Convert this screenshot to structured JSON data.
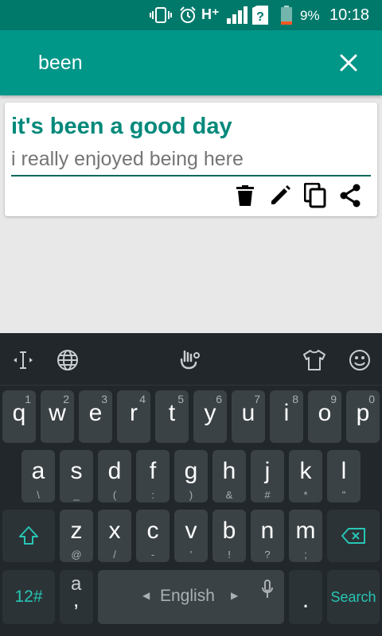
{
  "status_bar": {
    "network": "H⁺",
    "battery_percent": "9%",
    "time": "10:18"
  },
  "search": {
    "value": "been"
  },
  "card": {
    "title": "it's been a good day",
    "subtitle": "i really enjoyed being here"
  },
  "keyboard": {
    "row1": [
      {
        "key": "q",
        "hint": "1"
      },
      {
        "key": "w",
        "hint": "2"
      },
      {
        "key": "e",
        "hint": "3"
      },
      {
        "key": "r",
        "hint": "4"
      },
      {
        "key": "t",
        "hint": "5"
      },
      {
        "key": "y",
        "hint": "6"
      },
      {
        "key": "u",
        "hint": "7"
      },
      {
        "key": "i",
        "hint": "8"
      },
      {
        "key": "o",
        "hint": "9"
      },
      {
        "key": "p",
        "hint": "0"
      }
    ],
    "row2": [
      {
        "key": "a",
        "sub": "\\"
      },
      {
        "key": "s",
        "sub": "_"
      },
      {
        "key": "d",
        "sub": "("
      },
      {
        "key": "f",
        "sub": ":"
      },
      {
        "key": "g",
        "sub": ")"
      },
      {
        "key": "h",
        "sub": "&"
      },
      {
        "key": "j",
        "sub": "#"
      },
      {
        "key": "k",
        "sub": "*"
      },
      {
        "key": "l",
        "sub": "\""
      }
    ],
    "row3": [
      {
        "key": "z",
        "sub": "@"
      },
      {
        "key": "x",
        "sub": "/"
      },
      {
        "key": "c",
        "sub": "-"
      },
      {
        "key": "v",
        "sub": "'"
      },
      {
        "key": "b",
        "sub": "!"
      },
      {
        "key": "n",
        "sub": "?"
      },
      {
        "key": "m",
        "sub": ";"
      }
    ],
    "symbols_label": "12#",
    "punct_main": "a",
    "punct_sub": ",",
    "space_label": "English",
    "period_label": ".",
    "search_label": "Search"
  },
  "colors": {
    "status_bar": "#00796b",
    "app_bar": "#009688",
    "accent_title": "#00897b",
    "keyboard_bg": "#21272b",
    "key_bg": "#3b4246",
    "keyboard_accent": "#26c6b4"
  }
}
